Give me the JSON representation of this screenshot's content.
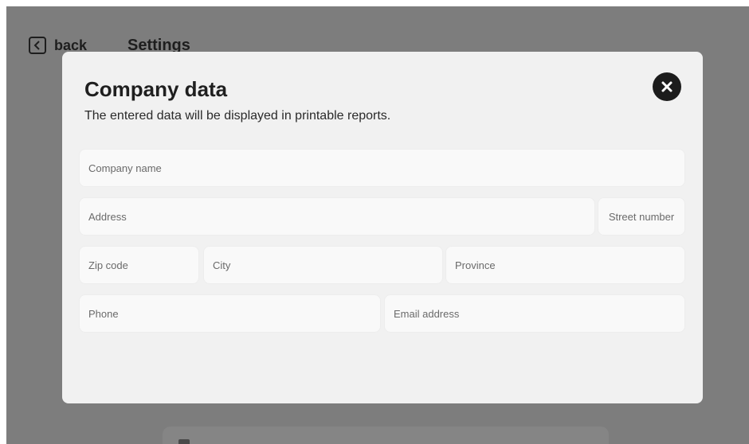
{
  "header": {
    "back_label": "back",
    "title": "Settings"
  },
  "modal": {
    "title": "Company data",
    "subtitle": "The entered data will be displayed in printable reports.",
    "close_icon": "close-icon",
    "fields": {
      "company_name": {
        "placeholder": "Company name"
      },
      "address": {
        "placeholder": "Address"
      },
      "street_number": {
        "placeholder": "Street number"
      },
      "zip_code": {
        "placeholder": "Zip code"
      },
      "city": {
        "placeholder": "City"
      },
      "province": {
        "placeholder": "Province"
      },
      "phone": {
        "placeholder": "Phone"
      },
      "email": {
        "placeholder": "Email address"
      }
    }
  },
  "colors": {
    "overlay": "#7d7d7d",
    "modal_bg": "#f1f1f1",
    "field_bg": "#f9f9f9",
    "close_button": "#1c1c1c"
  }
}
